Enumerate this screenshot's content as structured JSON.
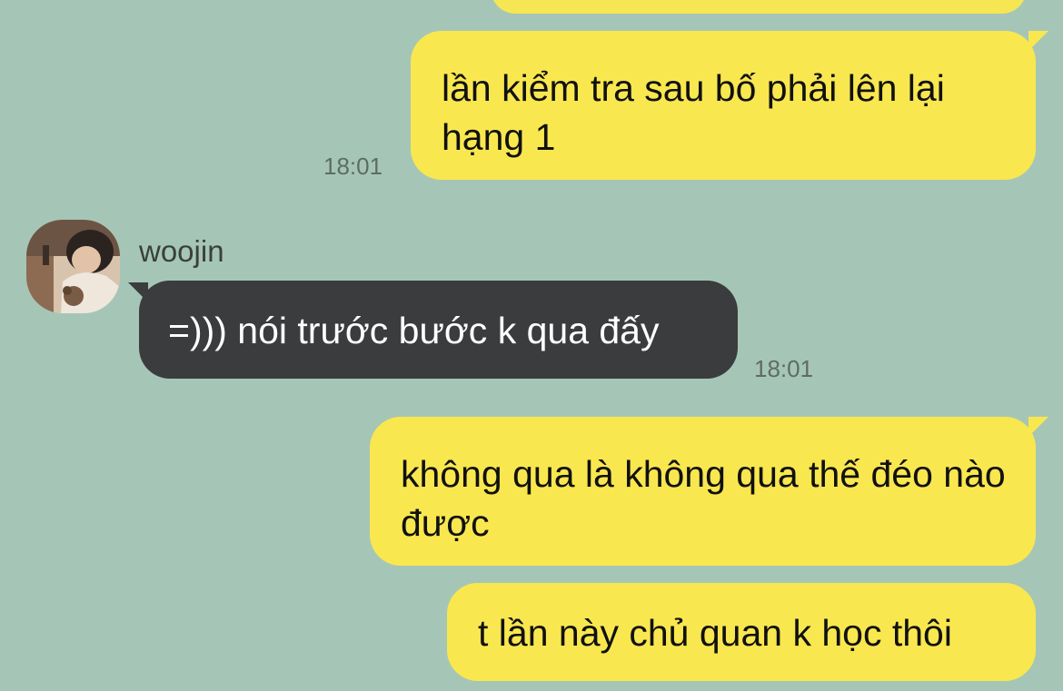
{
  "chat": {
    "messages": [
      {
        "side": "outgoing",
        "text": "lần kiểm tra sau bố phải lên lại hạng 1",
        "time": "18:01"
      },
      {
        "side": "incoming",
        "sender": "woojin",
        "text": "=))) nói trước bước k qua đấy",
        "time": "18:01"
      },
      {
        "side": "outgoing",
        "text": "không qua là không qua thế đéo nào được",
        "time": ""
      },
      {
        "side": "outgoing",
        "text": "t lần này chủ quan k học thôi",
        "time": ""
      }
    ]
  },
  "colors": {
    "background": "#a5c6b7",
    "outgoing_bubble": "#f9e74f",
    "incoming_bubble": "#3b3c3e",
    "timestamp": "#5f6b66"
  }
}
